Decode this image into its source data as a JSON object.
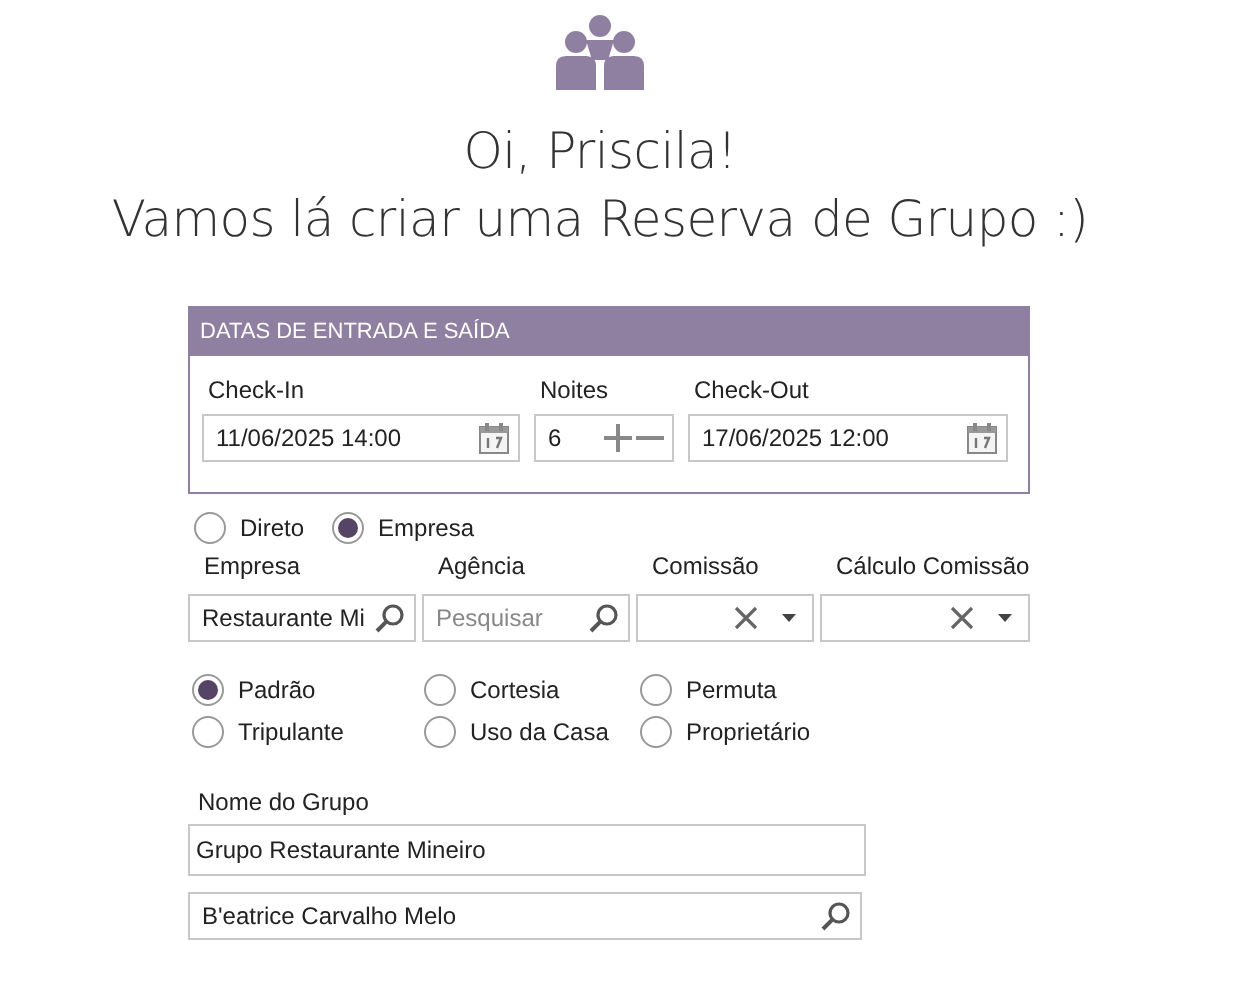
{
  "header": {
    "greeting": "Oi, Priscila!",
    "subtitle": "Vamos lá criar uma Reserva de Grupo :)"
  },
  "dates": {
    "title": "DATAS DE ENTRADA E SAÍDA",
    "checkin": {
      "label": "Check-In",
      "value": "11/06/2025 14:00"
    },
    "nights": {
      "label": "Noites",
      "value": "6"
    },
    "checkout": {
      "label": "Check-Out",
      "value": "17/06/2025 12:00"
    }
  },
  "origin": [
    {
      "label": "Direto",
      "selected": false
    },
    {
      "label": "Empresa",
      "selected": true
    }
  ],
  "commercial_fields": [
    {
      "kind": "search",
      "label": "Empresa",
      "value": "Restaurante Mi"
    },
    {
      "kind": "search",
      "label": "Agência",
      "placeholder": "Pesquisar"
    },
    {
      "kind": "select",
      "label": "Comissão"
    },
    {
      "kind": "select",
      "label": "Cálculo Comissão"
    }
  ],
  "reservation_types": [
    {
      "label": "Padrão",
      "selected": true
    },
    {
      "label": "Cortesia",
      "selected": false
    },
    {
      "label": "Permuta",
      "selected": false
    },
    {
      "label": "Tripulante",
      "selected": false
    },
    {
      "label": "Uso da Casa",
      "selected": false
    },
    {
      "label": "Proprietário",
      "selected": false
    }
  ],
  "group_name": {
    "label": "Nome do Grupo",
    "value": "Grupo Restaurante Mineiro"
  },
  "guest_search": {
    "value": "B'eatrice Carvalho Melo"
  }
}
